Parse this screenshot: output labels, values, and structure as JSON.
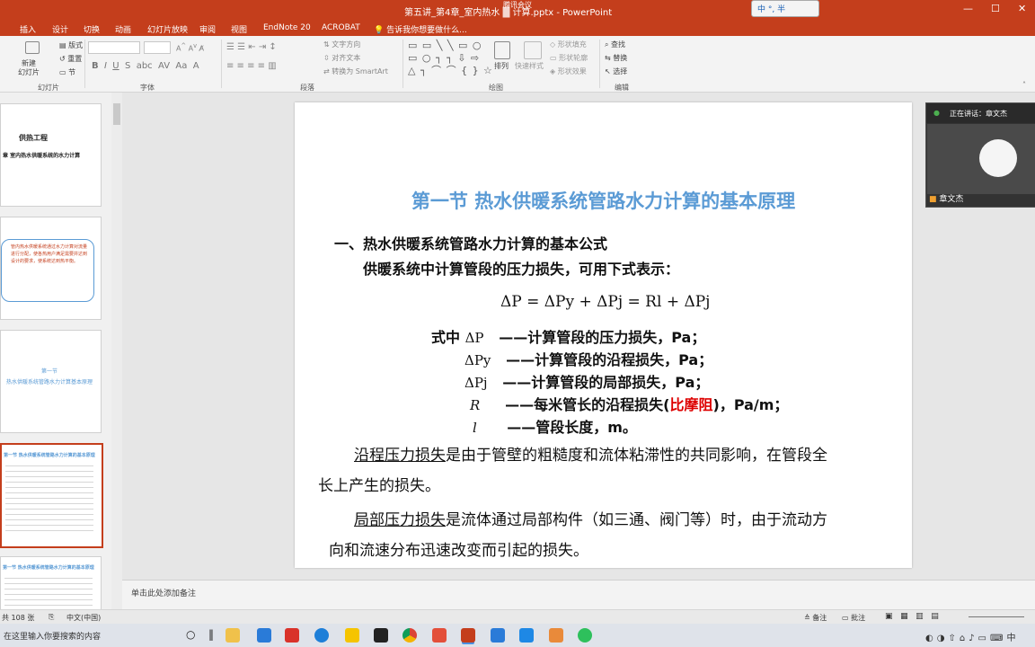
{
  "app": {
    "window_title": "第五讲_第4章_室内热水供暖系统的水力计算.pptx - PowerPoint",
    "title_left": "第五讲_第4章_室内热水",
    "title_right": "计算.pptx - PowerPoint",
    "meeting_tag": "腾讯会议"
  },
  "ime": {
    "label": "中 °, 半"
  },
  "ribbon_tabs": [
    {
      "label": "插入"
    },
    {
      "label": "设计"
    },
    {
      "label": "切换"
    },
    {
      "label": "动画"
    },
    {
      "label": "幻灯片放映"
    },
    {
      "label": "审阅"
    },
    {
      "label": "视图"
    },
    {
      "label": "EndNote 20"
    },
    {
      "label": "ACROBAT"
    },
    {
      "label": "告诉我你想要做什么..."
    }
  ],
  "ribbon": {
    "new_slide": "新建\n幻灯片",
    "layout": "版式",
    "reset": "重置",
    "section": "节",
    "group_slides": "幻灯片",
    "group_font": "字体",
    "group_paragraph": "段落",
    "group_drawing": "绘图",
    "group_editing": "编辑",
    "text_direction": "文字方向",
    "align_text": "对齐文本",
    "convert_smartart": "转换为 SmartArt",
    "arrange": "排列",
    "quick_styles": "快速样式",
    "shape_fill": "形状填充",
    "shape_outline": "形状轮廓",
    "shape_effects": "形状效果",
    "find": "查找",
    "replace": "替换",
    "select": "选择"
  },
  "thumbnails": [
    {
      "title": "供热工程",
      "subtitle": "章 室内热水供暖系统的水力计算"
    },
    {
      "text": "管内热水供暖系统通过水力计算对流量进行分配，使各热用户满足需要并达到设计的要求，使系统达到热平衡。"
    },
    {
      "title": "第一节",
      "subtitle": "热水供暖系统管路水力计算基本原理"
    },
    {
      "title": "第一节 热水供暖系统管路水力计算的基本原理"
    },
    {
      "title": "第一节 热水供暖系统管路水力计算的基本原理"
    }
  ],
  "slide": {
    "title": "第一节 热水供暖系统管路水力计算的基本原理",
    "heading1": "一、热水供暖系统管路水力计算的基本公式",
    "heading2": "供暖系统中计算管段的压力损失，可用下式表示：",
    "formula": "ΔP = ΔPy + ΔPj = Rl + ΔPj",
    "def_prefix": "式中",
    "definitions": [
      {
        "symbol": "ΔP",
        "text": "——计算管段的压力损失，Pa；"
      },
      {
        "symbol": "ΔPy",
        "text": "——计算管段的沿程损失，Pa；"
      },
      {
        "symbol": "ΔPj",
        "text": "——计算管段的局部损失，Pa；"
      },
      {
        "symbol": "R",
        "text": "——每米管长的沿程损失(",
        "red": "比摩阻",
        "tail": ")，Pa/m；"
      },
      {
        "symbol": "l",
        "text": "——管段长度，m。"
      }
    ],
    "para1_term": "沿程压力损失",
    "para1_line1": "是由于管壁的粗糙度和流体粘滞性的共同影响，在管段全",
    "para1_line2": "长上产生的损失。",
    "para2_term": "局部压力损失",
    "para2_line1": "是流体通过局部构件（如三通、阀门等）时，由于流动方",
    "para2_line2": "向和流速分布迅速改变而引起的损失。"
  },
  "notes": {
    "placeholder": "单击此处添加备注"
  },
  "status": {
    "slide_count": "共 108 张",
    "language": "中文(中国)",
    "notes_btn": "备注",
    "comments_btn": "批注"
  },
  "meeting": {
    "speaking": "正在讲话：章文杰",
    "participant": "章文杰"
  },
  "taskbar": {
    "search_placeholder": "在这里输入你要搜索的内容"
  },
  "colors": {
    "accent": "#c43e1c",
    "title_blue": "#5b9bd5",
    "emphasis_red": "#dd0000"
  }
}
